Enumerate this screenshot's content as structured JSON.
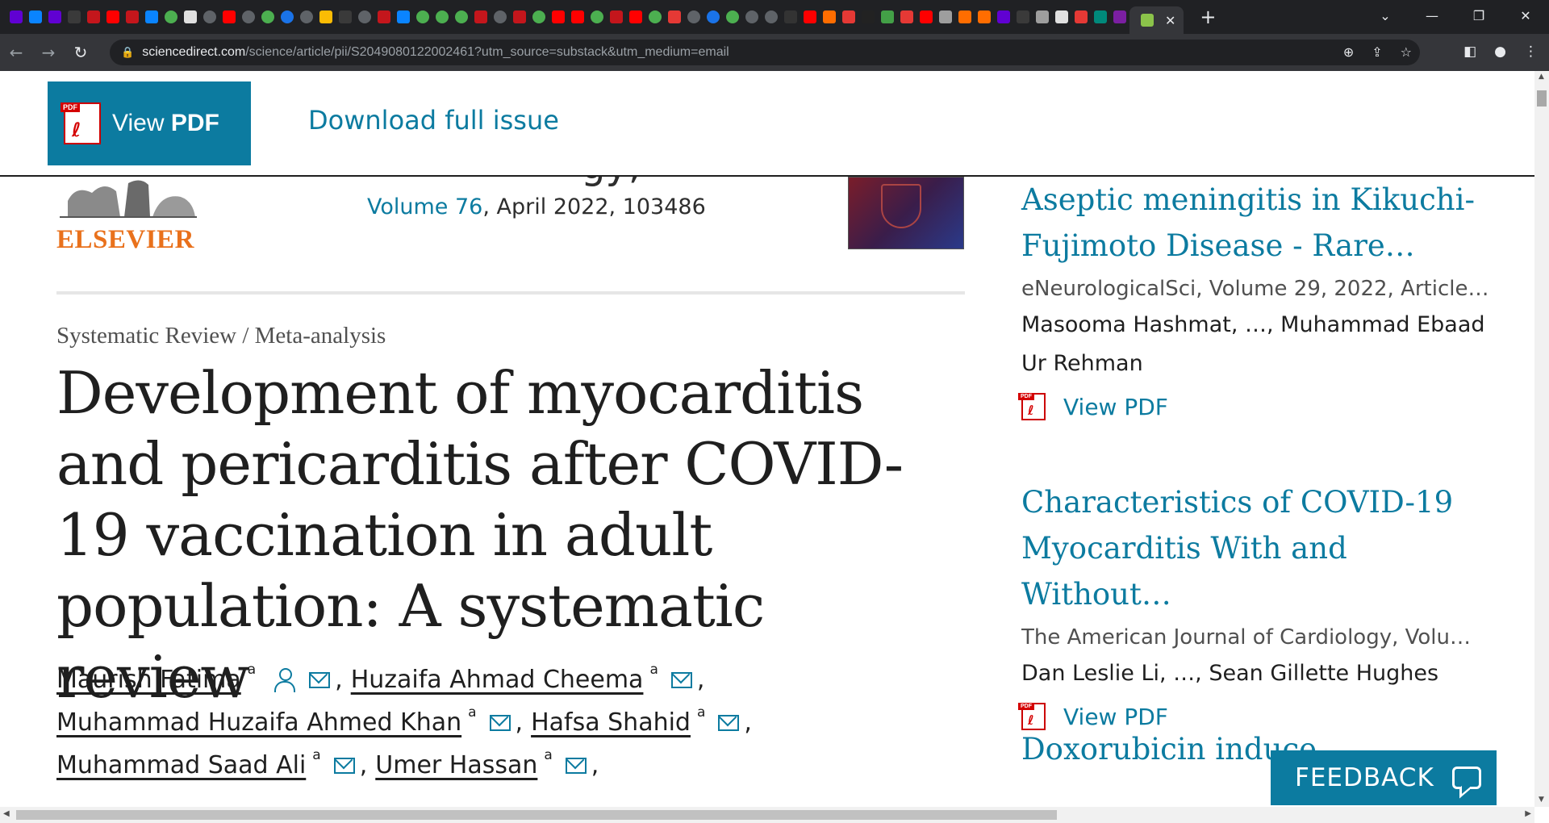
{
  "browser": {
    "url_host": "sciencedirect.com",
    "url_path": "/science/article/pii/S2049080122002461?utm_source=substack&utm_medium=email",
    "tab_favicons": [
      "yahoo",
      "edge",
      "yahoo",
      "li",
      "bi",
      "yt",
      "bi",
      "edge",
      "play",
      "grid",
      "round",
      "yt",
      "round",
      "play",
      "search",
      "round",
      "g",
      "li",
      "round",
      "bi",
      "edge",
      "play",
      "play",
      "play",
      "bi",
      "round",
      "bi",
      "play",
      "yt",
      "yt",
      "play",
      "bi",
      "yt",
      "play",
      "mic",
      "round",
      "search",
      "play",
      "round",
      "round",
      "nyt",
      "yt",
      "bookmark",
      "mic",
      "theta",
      "g9",
      "mic",
      "yt",
      "person",
      "bookmark",
      "bookmark",
      "yahoo",
      "li",
      "person",
      "grid",
      "mic",
      "tag",
      "mail"
    ],
    "window_controls": [
      "chevron-down-icon",
      "minimize-icon",
      "restore-icon",
      "close-icon"
    ]
  },
  "topbar": {
    "view_pdf_prefix": "View ",
    "view_pdf_bold": "PDF",
    "pdf_badge": "PDF",
    "download_issue": "Download full issue"
  },
  "publisher": {
    "logo_text": "ELSEVIER",
    "journal_partial": "gy,"
  },
  "issue": {
    "volume_link": "Volume 76",
    "volume_rest": ", April 2022, 103486"
  },
  "article": {
    "type": "Systematic Review / Meta-analysis",
    "title": "Development of myocarditis and pericarditis after COVID-19 vaccination in adult population: A systematic review",
    "authors": [
      {
        "name": "Maurish Fatima",
        "aff": "a"
      },
      {
        "name": "Huzaifa Ahmad Cheema",
        "aff": "a"
      },
      {
        "name": "Muhammad Huzaifa Ahmed Khan",
        "aff": "a"
      },
      {
        "name": "Hafsa Shahid",
        "aff": "a"
      },
      {
        "name": "Muhammad Saad Ali",
        "aff": "a"
      },
      {
        "name": "Umer Hassan",
        "aff": "a"
      }
    ]
  },
  "sidebar": {
    "recommendations": [
      {
        "title": "Aseptic meningitis in Kikuchi-Fujimoto Disease - Rare…",
        "source": "eNeurologicalSci, Volume 29, 2022, Article…",
        "authors": "Masooma Hashmat, …, Muhammad Ebaad Ur Rehman",
        "pdf_label": "View PDF"
      },
      {
        "title": "Characteristics of COVID-19 Myocarditis With and Without…",
        "source": "The American Journal of Cardiology, Volu…",
        "authors": "Dan Leslie Li, …, Sean Gillette Hughes",
        "pdf_label": "View PDF"
      },
      {
        "title": "Doxorubicin induce",
        "source": "",
        "authors": "",
        "pdf_label": ""
      }
    ]
  },
  "feedback": {
    "label": "FEEDBACK"
  },
  "colors": {
    "brand_blue": "#0c7ba0",
    "elsevier_orange": "#e9711c",
    "pdf_red": "#d40000"
  }
}
